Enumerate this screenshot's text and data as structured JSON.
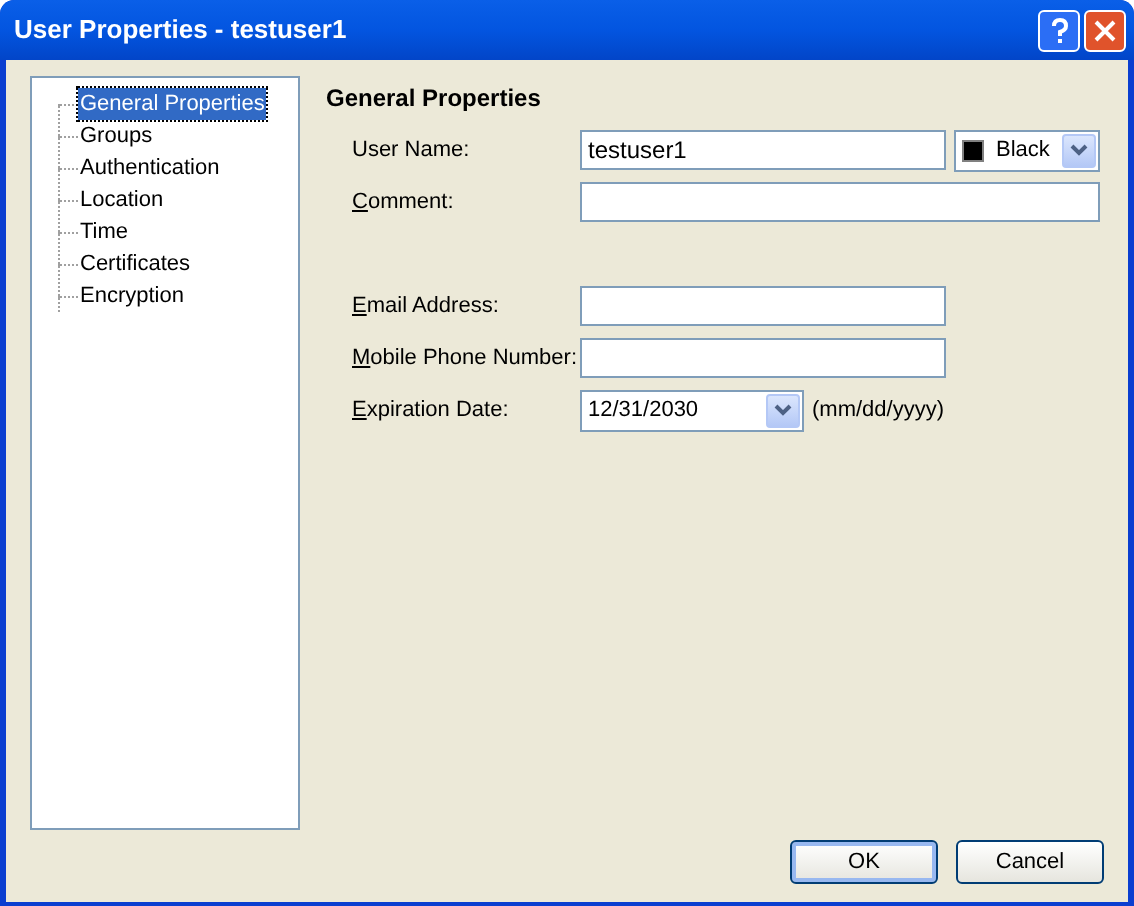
{
  "window": {
    "title": "User Properties - testuser1"
  },
  "tree": {
    "items": [
      {
        "label": "General Properties",
        "selected": true
      },
      {
        "label": "Groups",
        "selected": false
      },
      {
        "label": "Authentication",
        "selected": false
      },
      {
        "label": "Location",
        "selected": false
      },
      {
        "label": "Time",
        "selected": false
      },
      {
        "label": "Certificates",
        "selected": false
      },
      {
        "label": "Encryption",
        "selected": false
      }
    ]
  },
  "section": {
    "heading": "General Properties"
  },
  "fields": [
    {
      "kind": "text",
      "label": "User Name:",
      "underline_first": false,
      "value": "testuser1",
      "color_select": {
        "value": "Black",
        "color": "#000000"
      }
    },
    {
      "kind": "wide",
      "label": "Comment:",
      "underline_first": true
    },
    {
      "kind": "gap"
    },
    {
      "kind": "text",
      "label": "Email Address:",
      "underline_first": true
    },
    {
      "kind": "text",
      "label": "Mobile Phone Number:",
      "underline_first": true
    },
    {
      "kind": "date",
      "label": "Expiration Date:",
      "underline_first": true,
      "value": "12/31/2030",
      "hint": "(mm/dd/yyyy)"
    }
  ],
  "buttons": [
    {
      "label": "OK",
      "default": true
    },
    {
      "label": "Cancel",
      "default": false
    }
  ]
}
